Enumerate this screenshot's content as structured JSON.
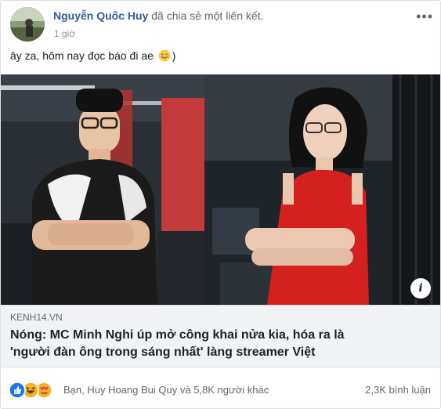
{
  "post": {
    "author_name": "Nguyễn Quốc Huy",
    "action_text": "đã chia sẻ một liên kết.",
    "timestamp": "1 giờ",
    "more_label": "•••",
    "status_text": "ây za, hôm nay đọc báo đi ae",
    "status_suffix": ")"
  },
  "link": {
    "info_label": "i",
    "domain": "KENH14.VN",
    "title_line1": "Nóng: MC Minh Nghi úp mở công khai nửa kia, hóa ra là",
    "title_line2": "'người đàn ông trong sáng nhất' làng streamer Việt"
  },
  "reactions": {
    "icons": [
      "like-icon",
      "haha-icon",
      "love-icon"
    ],
    "summary": "Bạn, Huy Hoang Bui Quy và 5,8K người khác",
    "comments": "2,3K bình luận"
  },
  "colors": {
    "author": "#385898",
    "like": "#1877f2",
    "love": "#f33e58",
    "haha": "#f7b125",
    "link_bg": "#f2f3f5"
  }
}
